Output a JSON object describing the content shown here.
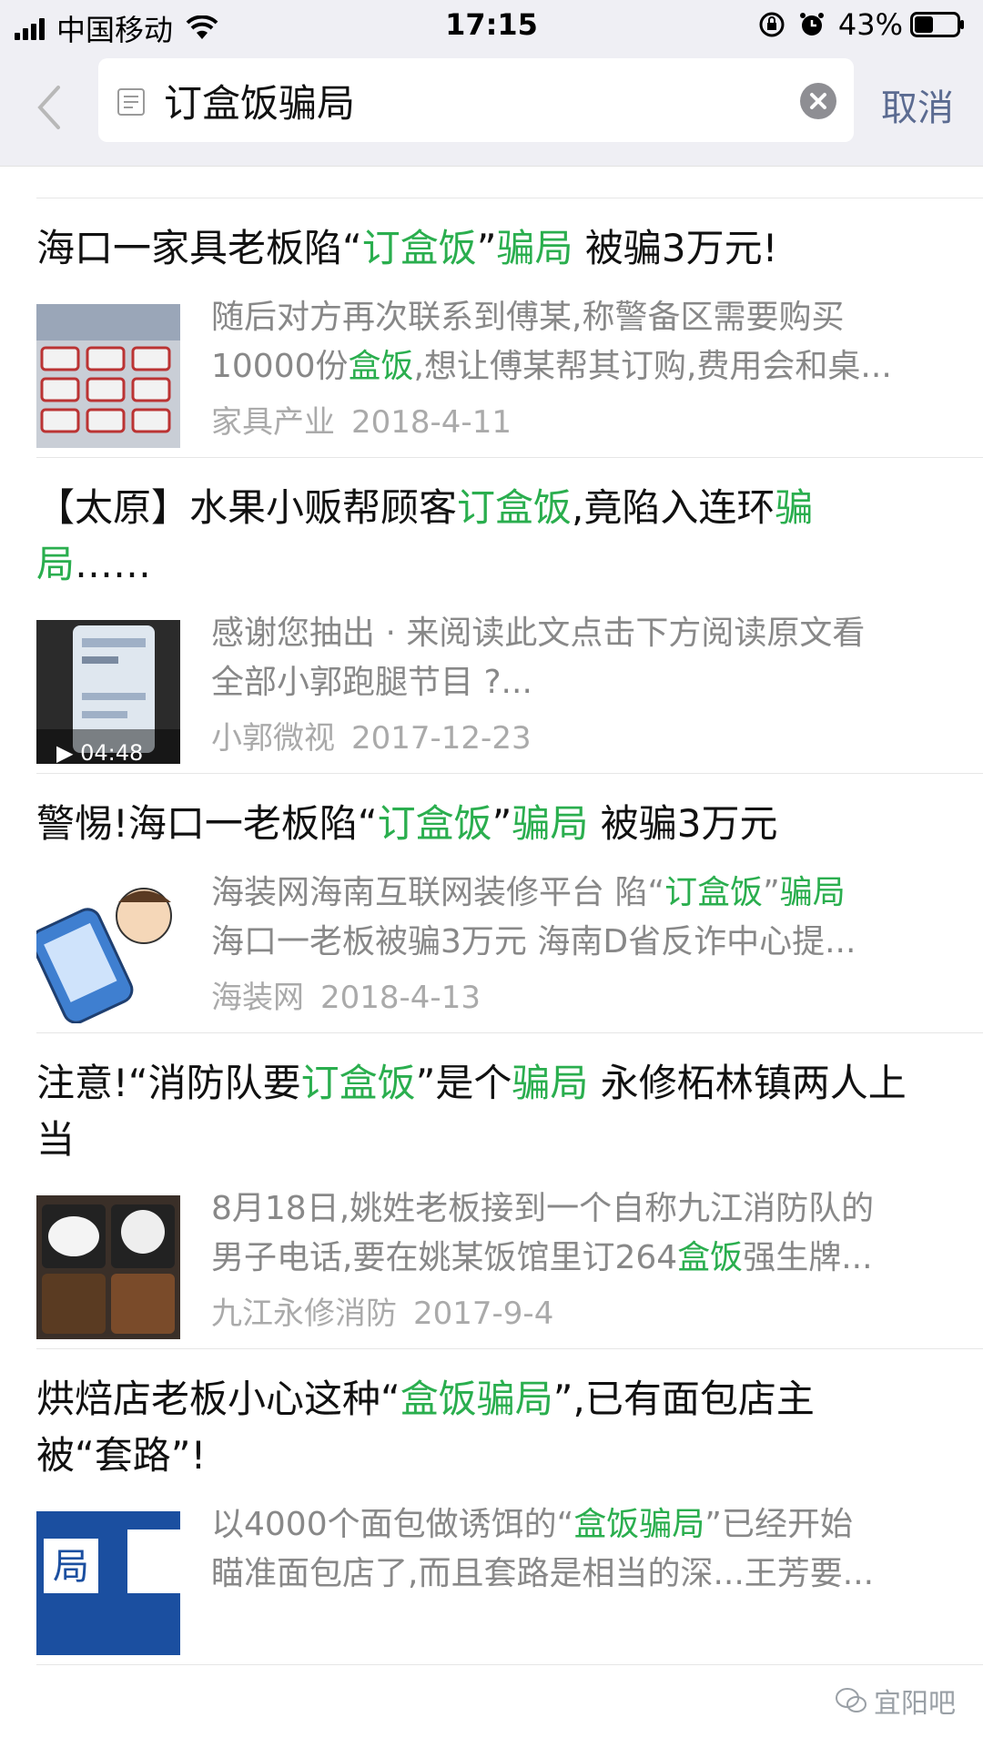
{
  "status_bar": {
    "carrier": "中国移动",
    "time": "17:15",
    "battery": "43%"
  },
  "search": {
    "query": "订盒饭骗局",
    "cancel_label": "取消"
  },
  "results": [
    {
      "title_parts": [
        {
          "t": "海口一家具老板陷“"
        },
        {
          "t": "订盒饭",
          "hl": true
        },
        {
          "t": "”"
        },
        {
          "t": "骗局",
          "hl": true
        },
        {
          "t": " 被骗3万元!"
        }
      ],
      "summary_lines": [
        [
          {
            "t": "随后对方再次联系到傅某,称警备区需要购买"
          }
        ],
        [
          {
            "t": "10000份"
          },
          {
            "t": "盒饭",
            "hl": true
          },
          {
            "t": ",想让傅某帮其订购,费用会和桌..."
          }
        ]
      ],
      "source": "家具产业",
      "date": "2018-4-11"
    },
    {
      "title_parts": [
        {
          "t": "【太原】水果小贩帮顾客"
        },
        {
          "t": "订盒饭",
          "hl": true
        },
        {
          "t": ",竟陷入连环"
        },
        {
          "t": "骗局",
          "hl": true
        },
        {
          "t": "……"
        }
      ],
      "summary_lines": [
        [
          {
            "t": "感谢您抽出 · 来阅读此文点击下方阅读原文看"
          }
        ],
        [
          {
            "t": "全部小郭跑腿节目 ?..."
          }
        ]
      ],
      "source": "小郭微视",
      "date": "2017-12-23",
      "video_duration": "04:48"
    },
    {
      "title_parts": [
        {
          "t": "警惕!海口一老板陷“"
        },
        {
          "t": "订盒饭",
          "hl": true
        },
        {
          "t": "”"
        },
        {
          "t": "骗局",
          "hl": true
        },
        {
          "t": " 被骗3万元"
        }
      ],
      "summary_lines": [
        [
          {
            "t": "海装网海南互联网装修平台 陷“"
          },
          {
            "t": "订盒饭",
            "hl": true
          },
          {
            "t": "”"
          },
          {
            "t": "骗局",
            "hl": true
          }
        ],
        [
          {
            "t": "海口一老板被骗3万元 海南D省反诈中心提..."
          }
        ]
      ],
      "source": "海装网",
      "date": "2018-4-13"
    },
    {
      "title_parts": [
        {
          "t": "注意!“消防队要"
        },
        {
          "t": "订盒饭",
          "hl": true
        },
        {
          "t": "”是个"
        },
        {
          "t": "骗局",
          "hl": true
        },
        {
          "t": " 永修柘林镇两人上当"
        }
      ],
      "summary_lines": [
        [
          {
            "t": "8月18日,姚姓老板接到一个自称九江消防队的"
          }
        ],
        [
          {
            "t": "男子电话,要在姚某饭馆里订264"
          },
          {
            "t": "盒饭",
            "hl": true
          },
          {
            "t": "强生牌..."
          }
        ]
      ],
      "source": "九江永修消防",
      "date": "2017-9-4"
    },
    {
      "title_parts": [
        {
          "t": "烘焙店老板小心这种“"
        },
        {
          "t": "盒饭骗局",
          "hl": true
        },
        {
          "t": "”,已有面包店主被“套路”!"
        }
      ],
      "summary_lines": [
        [
          {
            "t": "以4000个面包做诱饵的“"
          },
          {
            "t": "盒饭骗局",
            "hl": true
          },
          {
            "t": "”已经开始"
          }
        ],
        [
          {
            "t": "瞄准面包店了,而且套路是相当的深...王芳要..."
          }
        ]
      ],
      "source": "",
      "date": "",
      "thumb_text": "局"
    }
  ],
  "watermark": "宜阳吧",
  "colors": {
    "highlight": "#2aae4e",
    "header_bg": "#efeff4",
    "cancel": "#5b6b91",
    "summary": "#888888",
    "meta": "#aaaaaa"
  }
}
